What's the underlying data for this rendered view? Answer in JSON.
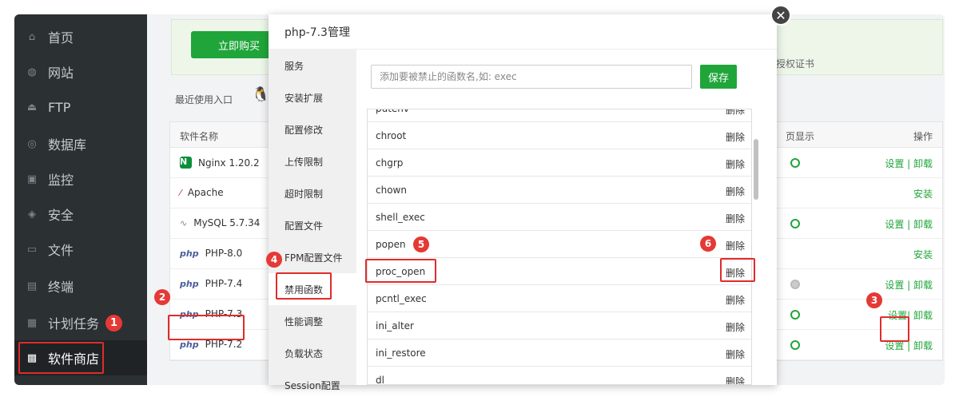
{
  "sidebar": {
    "items": [
      {
        "label": "首页",
        "icon": "home-icon"
      },
      {
        "label": "网站",
        "icon": "globe-icon"
      },
      {
        "label": "FTP",
        "icon": "ftp-icon"
      },
      {
        "label": "数据库",
        "icon": "database-icon"
      },
      {
        "label": "监控",
        "icon": "monitor-icon"
      },
      {
        "label": "安全",
        "icon": "shield-icon"
      },
      {
        "label": "文件",
        "icon": "folder-icon"
      },
      {
        "label": "终端",
        "icon": "terminal-icon"
      },
      {
        "label": "计划任务",
        "icon": "calendar-icon"
      },
      {
        "label": "软件商店",
        "icon": "grid-icon"
      }
    ]
  },
  "main": {
    "buy_label": "立即购买",
    "license_text": "各授权证书",
    "recent_label": "最近使用入口",
    "table": {
      "col_name": "软件名称",
      "col_display": "页显示",
      "col_action": "操作",
      "rows": [
        {
          "name": "Nginx 1.20.2",
          "op": "设置 | 卸载"
        },
        {
          "name": "Apache",
          "op": "安装"
        },
        {
          "name": "MySQL 5.7.34",
          "op": "设置 | 卸载"
        },
        {
          "name": "PHP-8.0",
          "op": "安装"
        },
        {
          "name": "PHP-7.4",
          "op": "设置 | 卸载"
        },
        {
          "name": "PHP-7.3",
          "op_set": "设置",
          "op_uninstall": "| 卸载"
        },
        {
          "name": "PHP-7.2",
          "op": "设置 | 卸载"
        }
      ]
    }
  },
  "modal": {
    "title": "php-7.3管理",
    "nav": [
      "服务",
      "安装扩展",
      "配置修改",
      "上传限制",
      "超时限制",
      "配置文件",
      "FPM配置文件",
      "禁用函数",
      "性能调整",
      "负载状态",
      "Session配置"
    ],
    "input_placeholder": "添加要被禁止的函数名,如: exec",
    "save_label": "保存",
    "functions": [
      "putenv",
      "chroot",
      "chgrp",
      "chown",
      "shell_exec",
      "popen",
      "proc_open",
      "pcntl_exec",
      "ini_alter",
      "ini_restore",
      "dl"
    ],
    "delete_label": "删除"
  },
  "annotations": [
    "1",
    "2",
    "3",
    "4",
    "5",
    "6"
  ],
  "colors": {
    "accent": "#20a53a",
    "annotation": "#e53935",
    "sidebar": "#2b3033"
  }
}
